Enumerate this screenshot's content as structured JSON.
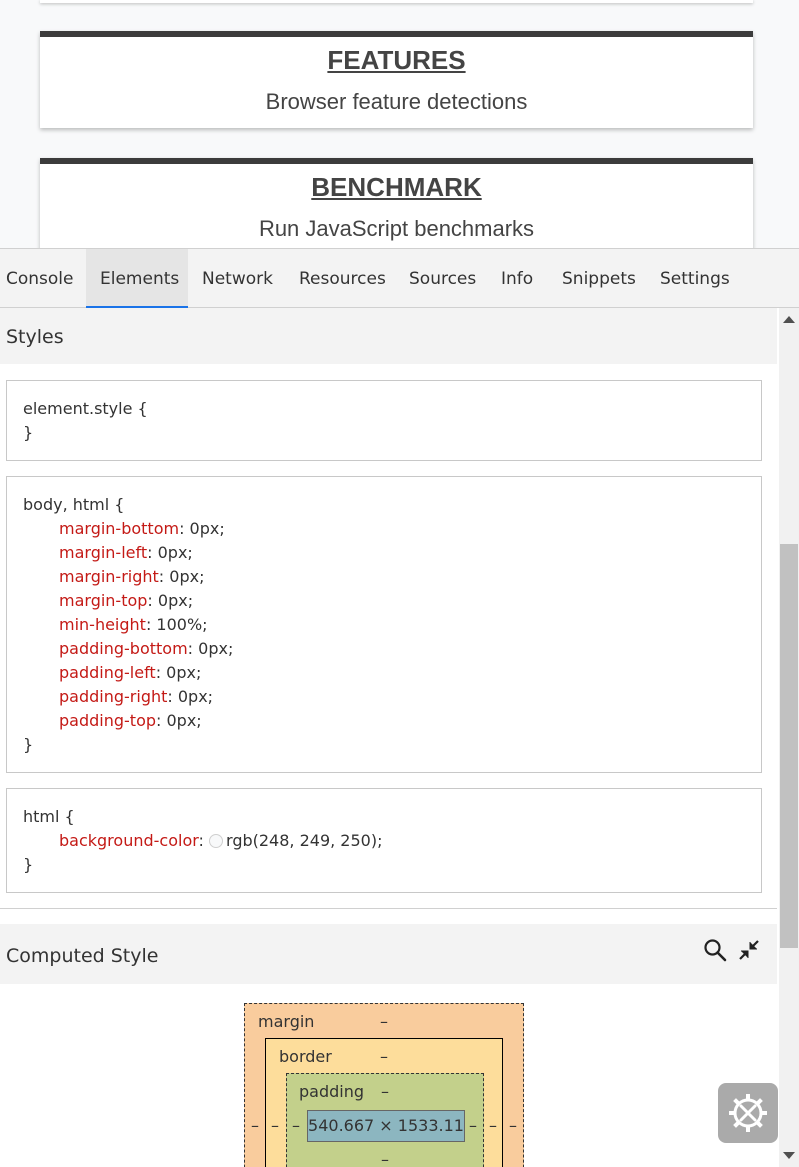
{
  "page": {
    "cards": [
      {
        "title": "FEATURES",
        "description": "Browser feature detections"
      },
      {
        "title": "BENCHMARK",
        "description": "Run JavaScript benchmarks"
      }
    ]
  },
  "devtools": {
    "tabs": [
      {
        "label": "Console"
      },
      {
        "label": "Elements",
        "active": true
      },
      {
        "label": "Network"
      },
      {
        "label": "Resources"
      },
      {
        "label": "Sources"
      },
      {
        "label": "Info"
      },
      {
        "label": "Snippets"
      },
      {
        "label": "Settings"
      }
    ],
    "styles": {
      "header": "Styles",
      "rules": [
        {
          "selector": "element.style {",
          "close": "}",
          "props": []
        },
        {
          "selector": "body, html {",
          "close": "}",
          "props": [
            {
              "name": "margin-bottom",
              "value": " 0px;"
            },
            {
              "name": "margin-left",
              "value": " 0px;"
            },
            {
              "name": "margin-right",
              "value": " 0px;"
            },
            {
              "name": "margin-top",
              "value": " 0px;"
            },
            {
              "name": "min-height",
              "value": " 100%;"
            },
            {
              "name": "padding-bottom",
              "value": " 0px;"
            },
            {
              "name": "padding-left",
              "value": " 0px;"
            },
            {
              "name": "padding-right",
              "value": " 0px;"
            },
            {
              "name": "padding-top",
              "value": " 0px;"
            }
          ]
        },
        {
          "selector": "html {",
          "close": "}",
          "props": [
            {
              "name": "background-color",
              "value": "rgb(248, 249, 250);",
              "swatch": "#f8f9fa"
            }
          ]
        }
      ]
    },
    "computed": {
      "header": "Computed Style",
      "box_model": {
        "margin_label": "margin",
        "border_label": "border",
        "padding_label": "padding",
        "dash": "–",
        "content_size": "540.667 × 1533.11"
      }
    },
    "icons": {
      "search": "search-icon",
      "collapse": "collapse-icon",
      "settings_fab": "wrench-screwdriver-gear-icon"
    },
    "colors": {
      "property_name": "#c41a16",
      "active_tab_underline": "#1a73e8",
      "margin": "#f9cc9d",
      "border": "#fddd9b",
      "padding": "#c3d08b",
      "content": "#8cb6c0"
    }
  }
}
